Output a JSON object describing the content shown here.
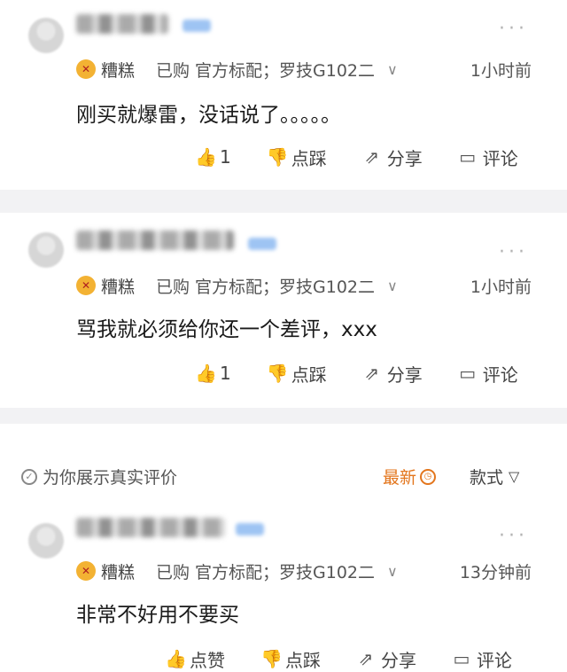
{
  "comments": [
    {
      "user_badge": "糟糕",
      "purchased": "已购",
      "spec": "官方标配；罗技G102二",
      "time": "1小时前",
      "text": "刚买就爆雷，没话说了。。。。。",
      "actions": {
        "like": "1",
        "dislike": "点踩",
        "share": "分享",
        "reply": "评论"
      }
    },
    {
      "user_badge": "糟糕",
      "purchased": "已购",
      "spec": "官方标配；罗技G102二",
      "time": "1小时前",
      "text": "骂我就必须给你还一个差评，xxx",
      "actions": {
        "like": "1",
        "dislike": "点踩",
        "share": "分享",
        "reply": "评论"
      }
    },
    {
      "user_badge": "糟糕",
      "purchased": "已购",
      "spec": "官方标配；罗技G102二",
      "time": "13分钟前",
      "text": "非常不好用不要买",
      "actions": {
        "like": "点赞",
        "dislike": "点踩",
        "share": "分享",
        "reply": "评论"
      }
    }
  ],
  "filter": {
    "authentic": "为你展示真实评价",
    "newest": "最新",
    "style": "款式"
  },
  "icons": {
    "more": "more-dots-icon",
    "like": "thumb-up-icon",
    "dislike": "thumb-down-icon",
    "share": "share-icon",
    "reply": "comment-icon"
  },
  "colors": {
    "accent_orange": "#e3761d",
    "separator": "#f2f2f4"
  }
}
